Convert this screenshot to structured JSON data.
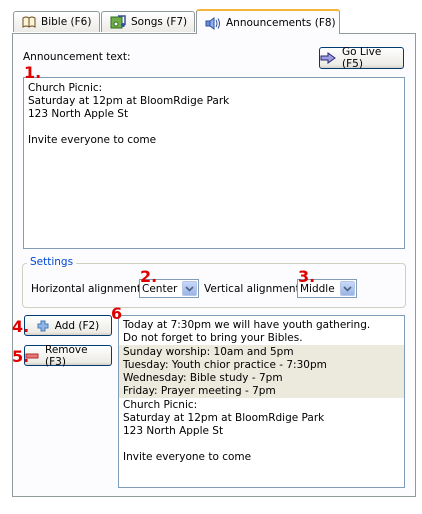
{
  "tabs": [
    {
      "label": "Bible (F6)",
      "icon": "bible-icon",
      "active": false
    },
    {
      "label": "Songs (F7)",
      "icon": "songs-icon",
      "active": false
    },
    {
      "label": "Announcements (F8)",
      "icon": "speaker-icon",
      "active": true
    }
  ],
  "announcement": {
    "label": "Announcement text:",
    "text_lines": [
      "Church Picnic:",
      "Saturday at 12pm at BloomRdige Park",
      "123 North Apple St",
      "",
      "Invite everyone to come"
    ]
  },
  "go_live_button": {
    "label": "Go Live (F5)",
    "icon": "arrow-right-icon"
  },
  "settings": {
    "title": "Settings",
    "horizontal_label": "Horizontal alignment:",
    "horizontal_value": "Center",
    "vertical_label": "Vertical alignment:",
    "vertical_value": "Middle"
  },
  "buttons": {
    "add_label": "Add (F2)",
    "remove_label": "Remove (F3)"
  },
  "list_items": [
    {
      "lines": [
        "Today at 7:30pm we will have youth gathering.",
        "Do not forget to bring your Bibles."
      ],
      "selected": false
    },
    {
      "lines": [
        "Sunday worship: 10am and 5pm",
        "Tuesday: Youth chior practice - 7:30pm",
        "Wednesday: Bible study - 7pm",
        "Friday: Prayer meeting - 7pm"
      ],
      "selected": true
    },
    {
      "lines": [
        "Church Picnic:",
        "Saturday at 12pm at BloomRdige Park",
        "123 North Apple St",
        "",
        "Invite everyone to come"
      ],
      "selected": false
    }
  ],
  "markers": [
    "1.",
    "2.",
    "3.",
    "4.",
    "5.",
    "6"
  ],
  "colors": {
    "marker": "#e00000",
    "tab_highlight": "#f4b43a",
    "legend": "#0046d5",
    "selected_row": "#ece9dd"
  }
}
